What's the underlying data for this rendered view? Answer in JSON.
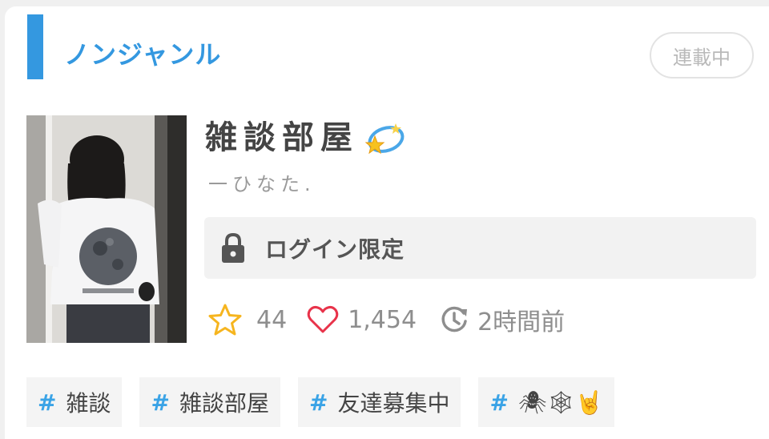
{
  "genre": {
    "label": "ノンジャンル",
    "accent": "#3498e0"
  },
  "status_badge": "連載中",
  "story": {
    "title": "雑談部屋",
    "title_emoji": "dizzy-star-emoji",
    "author": "一ひなた."
  },
  "access": {
    "label": "ログイン限定",
    "icon": "lock-icon"
  },
  "stats": {
    "stars": "44",
    "likes": "1,454",
    "updated": "2時間前"
  },
  "tags": [
    {
      "hash": "#",
      "label": "雑談"
    },
    {
      "hash": "#",
      "label": "雑談部屋"
    },
    {
      "hash": "#",
      "label": "友達募集中"
    },
    {
      "hash": "#",
      "label": "🕷🕸🤘"
    }
  ],
  "colors": {
    "star": "#f6b51f",
    "heart": "#e8334a",
    "muted": "#8e8e8e"
  }
}
